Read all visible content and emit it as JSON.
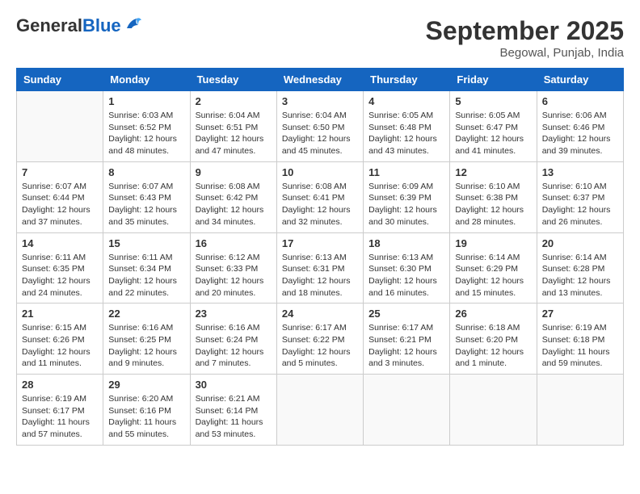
{
  "header": {
    "logo_general": "General",
    "logo_blue": "Blue",
    "month": "September 2025",
    "location": "Begowal, Punjab, India"
  },
  "weekdays": [
    "Sunday",
    "Monday",
    "Tuesday",
    "Wednesday",
    "Thursday",
    "Friday",
    "Saturday"
  ],
  "weeks": [
    [
      {
        "day": "",
        "info": ""
      },
      {
        "day": "1",
        "info": "Sunrise: 6:03 AM\nSunset: 6:52 PM\nDaylight: 12 hours\nand 48 minutes."
      },
      {
        "day": "2",
        "info": "Sunrise: 6:04 AM\nSunset: 6:51 PM\nDaylight: 12 hours\nand 47 minutes."
      },
      {
        "day": "3",
        "info": "Sunrise: 6:04 AM\nSunset: 6:50 PM\nDaylight: 12 hours\nand 45 minutes."
      },
      {
        "day": "4",
        "info": "Sunrise: 6:05 AM\nSunset: 6:48 PM\nDaylight: 12 hours\nand 43 minutes."
      },
      {
        "day": "5",
        "info": "Sunrise: 6:05 AM\nSunset: 6:47 PM\nDaylight: 12 hours\nand 41 minutes."
      },
      {
        "day": "6",
        "info": "Sunrise: 6:06 AM\nSunset: 6:46 PM\nDaylight: 12 hours\nand 39 minutes."
      }
    ],
    [
      {
        "day": "7",
        "info": "Sunrise: 6:07 AM\nSunset: 6:44 PM\nDaylight: 12 hours\nand 37 minutes."
      },
      {
        "day": "8",
        "info": "Sunrise: 6:07 AM\nSunset: 6:43 PM\nDaylight: 12 hours\nand 35 minutes."
      },
      {
        "day": "9",
        "info": "Sunrise: 6:08 AM\nSunset: 6:42 PM\nDaylight: 12 hours\nand 34 minutes."
      },
      {
        "day": "10",
        "info": "Sunrise: 6:08 AM\nSunset: 6:41 PM\nDaylight: 12 hours\nand 32 minutes."
      },
      {
        "day": "11",
        "info": "Sunrise: 6:09 AM\nSunset: 6:39 PM\nDaylight: 12 hours\nand 30 minutes."
      },
      {
        "day": "12",
        "info": "Sunrise: 6:10 AM\nSunset: 6:38 PM\nDaylight: 12 hours\nand 28 minutes."
      },
      {
        "day": "13",
        "info": "Sunrise: 6:10 AM\nSunset: 6:37 PM\nDaylight: 12 hours\nand 26 minutes."
      }
    ],
    [
      {
        "day": "14",
        "info": "Sunrise: 6:11 AM\nSunset: 6:35 PM\nDaylight: 12 hours\nand 24 minutes."
      },
      {
        "day": "15",
        "info": "Sunrise: 6:11 AM\nSunset: 6:34 PM\nDaylight: 12 hours\nand 22 minutes."
      },
      {
        "day": "16",
        "info": "Sunrise: 6:12 AM\nSunset: 6:33 PM\nDaylight: 12 hours\nand 20 minutes."
      },
      {
        "day": "17",
        "info": "Sunrise: 6:13 AM\nSunset: 6:31 PM\nDaylight: 12 hours\nand 18 minutes."
      },
      {
        "day": "18",
        "info": "Sunrise: 6:13 AM\nSunset: 6:30 PM\nDaylight: 12 hours\nand 16 minutes."
      },
      {
        "day": "19",
        "info": "Sunrise: 6:14 AM\nSunset: 6:29 PM\nDaylight: 12 hours\nand 15 minutes."
      },
      {
        "day": "20",
        "info": "Sunrise: 6:14 AM\nSunset: 6:28 PM\nDaylight: 12 hours\nand 13 minutes."
      }
    ],
    [
      {
        "day": "21",
        "info": "Sunrise: 6:15 AM\nSunset: 6:26 PM\nDaylight: 12 hours\nand 11 minutes."
      },
      {
        "day": "22",
        "info": "Sunrise: 6:16 AM\nSunset: 6:25 PM\nDaylight: 12 hours\nand 9 minutes."
      },
      {
        "day": "23",
        "info": "Sunrise: 6:16 AM\nSunset: 6:24 PM\nDaylight: 12 hours\nand 7 minutes."
      },
      {
        "day": "24",
        "info": "Sunrise: 6:17 AM\nSunset: 6:22 PM\nDaylight: 12 hours\nand 5 minutes."
      },
      {
        "day": "25",
        "info": "Sunrise: 6:17 AM\nSunset: 6:21 PM\nDaylight: 12 hours\nand 3 minutes."
      },
      {
        "day": "26",
        "info": "Sunrise: 6:18 AM\nSunset: 6:20 PM\nDaylight: 12 hours\nand 1 minute."
      },
      {
        "day": "27",
        "info": "Sunrise: 6:19 AM\nSunset: 6:18 PM\nDaylight: 11 hours\nand 59 minutes."
      }
    ],
    [
      {
        "day": "28",
        "info": "Sunrise: 6:19 AM\nSunset: 6:17 PM\nDaylight: 11 hours\nand 57 minutes."
      },
      {
        "day": "29",
        "info": "Sunrise: 6:20 AM\nSunset: 6:16 PM\nDaylight: 11 hours\nand 55 minutes."
      },
      {
        "day": "30",
        "info": "Sunrise: 6:21 AM\nSunset: 6:14 PM\nDaylight: 11 hours\nand 53 minutes."
      },
      {
        "day": "",
        "info": ""
      },
      {
        "day": "",
        "info": ""
      },
      {
        "day": "",
        "info": ""
      },
      {
        "day": "",
        "info": ""
      }
    ]
  ]
}
